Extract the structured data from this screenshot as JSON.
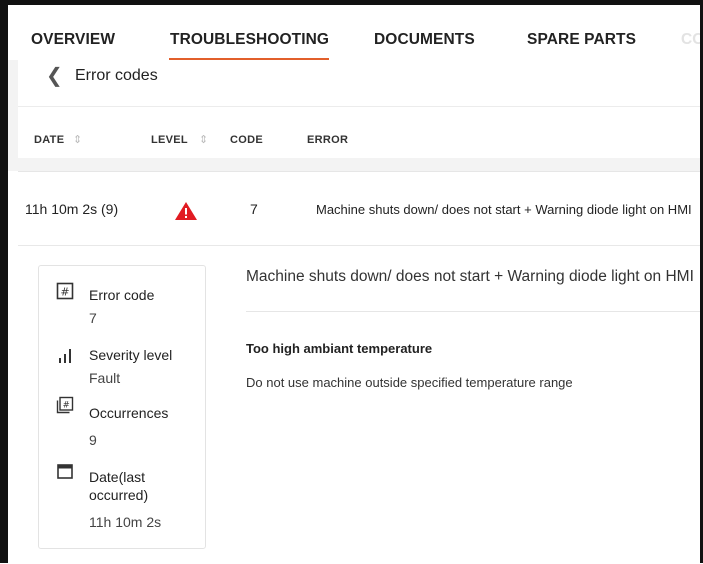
{
  "tabs": [
    {
      "label": "OVERVIEW",
      "active": false
    },
    {
      "label": "TROUBLESHOOTING",
      "active": true
    },
    {
      "label": "DOCUMENTS",
      "active": false
    },
    {
      "label": "SPARE PARTS",
      "active": false
    },
    {
      "label": "CO",
      "active": false
    }
  ],
  "page": {
    "title": "Error codes"
  },
  "table": {
    "headers": [
      "DATE",
      "LEVEL",
      "CODE",
      "ERROR"
    ]
  },
  "error_row": {
    "date": "11h 10m 2s (9)",
    "level_icon": "warning-triangle-icon",
    "code": "7",
    "error": "Machine shuts down/ does not start + Warning diode light on HMI"
  },
  "details": {
    "error_code_label": "Error code",
    "error_code_value": "7",
    "severity_label": "Severity level",
    "severity_value": "Fault",
    "occurrences_label": "Occurrences",
    "occurrences_value": "9",
    "date_label_line1": "Date(last",
    "date_label_line2": "occurred)",
    "date_value": "11h 10m 2s",
    "title": "Machine shuts down/ does not start + Warning diode light on HMI",
    "cause": "Too high ambiant temperature",
    "remedy": "Do not use machine outside specified temperature range"
  },
  "colors": {
    "accent": "#e25f2b",
    "warning": "#e11b22"
  }
}
